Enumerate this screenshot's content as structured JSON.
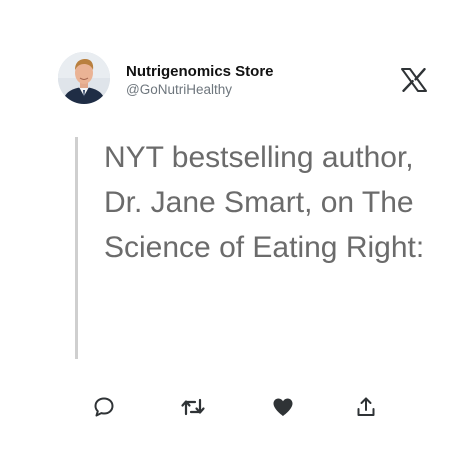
{
  "author": {
    "display_name": "Nutrigenomics Store",
    "handle": "@GoNutriHealthy",
    "avatar_icon": "person-photo"
  },
  "logo_icon": "x-logo-icon",
  "tweet": {
    "text": "NYT bestselling author, Dr. Jane Smart, on The Science of Eating Right:"
  },
  "actions": {
    "reply_icon": "reply-icon",
    "retweet_icon": "retweet-icon",
    "like_icon": "heart-icon",
    "share_icon": "share-icon"
  },
  "colors": {
    "name": "#111111",
    "handle": "#6e767d",
    "text": "#6b6b6b",
    "quote_bar": "#cfcfcf",
    "icons": "#2f3336"
  }
}
